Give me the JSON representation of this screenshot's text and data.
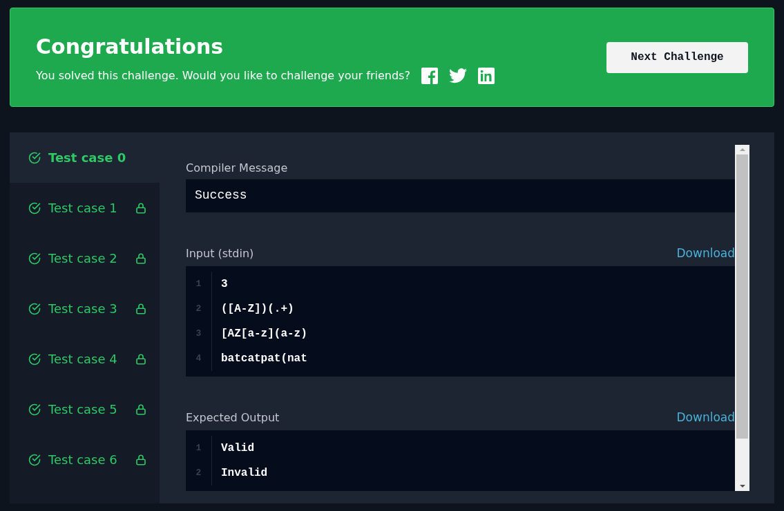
{
  "banner": {
    "title": "Congratulations",
    "message": "You solved this challenge. Would you like to challenge your friends?",
    "button": "Next Challenge"
  },
  "test_cases": [
    {
      "label": "Test case 0",
      "selected": true,
      "passed": true,
      "locked": false
    },
    {
      "label": "Test case 1",
      "selected": false,
      "passed": true,
      "locked": true
    },
    {
      "label": "Test case 2",
      "selected": false,
      "passed": true,
      "locked": true
    },
    {
      "label": "Test case 3",
      "selected": false,
      "passed": true,
      "locked": true
    },
    {
      "label": "Test case 4",
      "selected": false,
      "passed": true,
      "locked": true
    },
    {
      "label": "Test case 5",
      "selected": false,
      "passed": true,
      "locked": true
    },
    {
      "label": "Test case 6",
      "selected": false,
      "passed": true,
      "locked": true
    }
  ],
  "compiler_message": {
    "label": "Compiler Message",
    "value": "Success"
  },
  "input": {
    "label": "Input (stdin)",
    "download": "Download",
    "lines": [
      {
        "number": "1",
        "text": "3"
      },
      {
        "number": "2",
        "text": "([A-Z])(.+)"
      },
      {
        "number": "3",
        "text": "[AZ[a-z](a-z)"
      },
      {
        "number": "4",
        "text": "batcatpat(nat"
      }
    ]
  },
  "expected_output": {
    "label": "Expected Output",
    "download": "Download",
    "lines": [
      {
        "number": "1",
        "text": "Valid"
      },
      {
        "number": "2",
        "text": "Invalid"
      }
    ]
  }
}
